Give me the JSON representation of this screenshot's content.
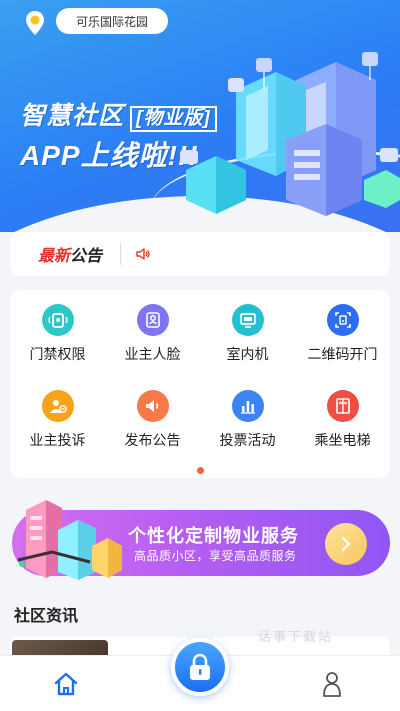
{
  "header": {
    "location": "可乐国际花园",
    "hero_title": "智慧社区",
    "hero_tag": "[物业版]",
    "hero_subtitle": "APP上线啦!!!"
  },
  "notice": {
    "label_new": "最新",
    "label_rest": "公告"
  },
  "grid": {
    "items": [
      {
        "label": "门禁权限",
        "icon": "door-access-icon",
        "color": "#2fc6c6"
      },
      {
        "label": "业主人脸",
        "icon": "face-user-icon",
        "color": "#7f74f2"
      },
      {
        "label": "室内机",
        "icon": "indoor-unit-icon",
        "color": "#26bfcf"
      },
      {
        "label": "二维码开门",
        "icon": "qr-door-icon",
        "color": "#2c6ef2"
      },
      {
        "label": "业主投诉",
        "icon": "complaint-icon",
        "color": "#f7a21b"
      },
      {
        "label": "发布公告",
        "icon": "megaphone-icon",
        "color": "#f47a4a"
      },
      {
        "label": "投票活动",
        "icon": "vote-chart-icon",
        "color": "#3c84f3"
      },
      {
        "label": "乘坐电梯",
        "icon": "elevator-icon",
        "color": "#ef4d46"
      }
    ]
  },
  "banner": {
    "title": "个性化定制物业服务",
    "subtitle": "高品质小区，享受高品质服务"
  },
  "news": {
    "section_title": "社区资讯",
    "watermark": "话事下载站"
  },
  "colors": {
    "brand_blue": "#2b7ef5",
    "accent_red": "#e8322c",
    "page_bg": "#f4f5f9"
  }
}
